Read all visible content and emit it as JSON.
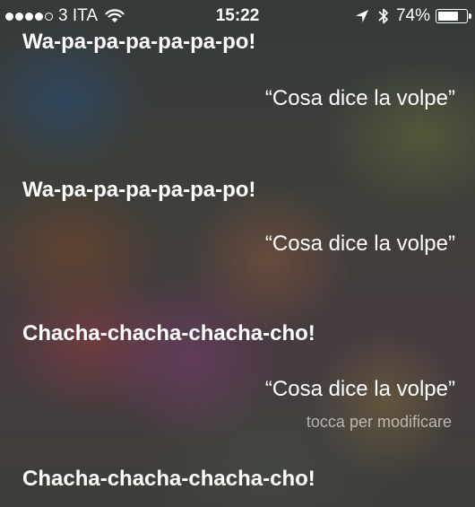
{
  "status_bar": {
    "signal_filled": 4,
    "signal_total": 5,
    "carrier": "3 ITA",
    "time": "15:22",
    "battery_percent": "74%",
    "battery_level": 0.74,
    "icons": [
      "wifi-icon",
      "location-arrow-icon",
      "bluetooth-icon",
      "battery-icon"
    ]
  },
  "conversation": {
    "messages": [
      {
        "role": "siri",
        "text": "Wa-pa-pa-pa-pa-pa-po!"
      },
      {
        "role": "user",
        "text": "“Cosa dice la volpe”"
      },
      {
        "role": "siri",
        "text": "Wa-pa-pa-pa-pa-pa-po!"
      },
      {
        "role": "user",
        "text": "“Cosa dice la volpe”"
      },
      {
        "role": "siri",
        "text": "Chacha-chacha-chacha-cho!"
      },
      {
        "role": "user",
        "text": "“Cosa dice la volpe”"
      },
      {
        "role": "siri",
        "text": "Chacha-chacha-chacha-cho!"
      }
    ],
    "edit_hint": "tocca per modificare"
  }
}
